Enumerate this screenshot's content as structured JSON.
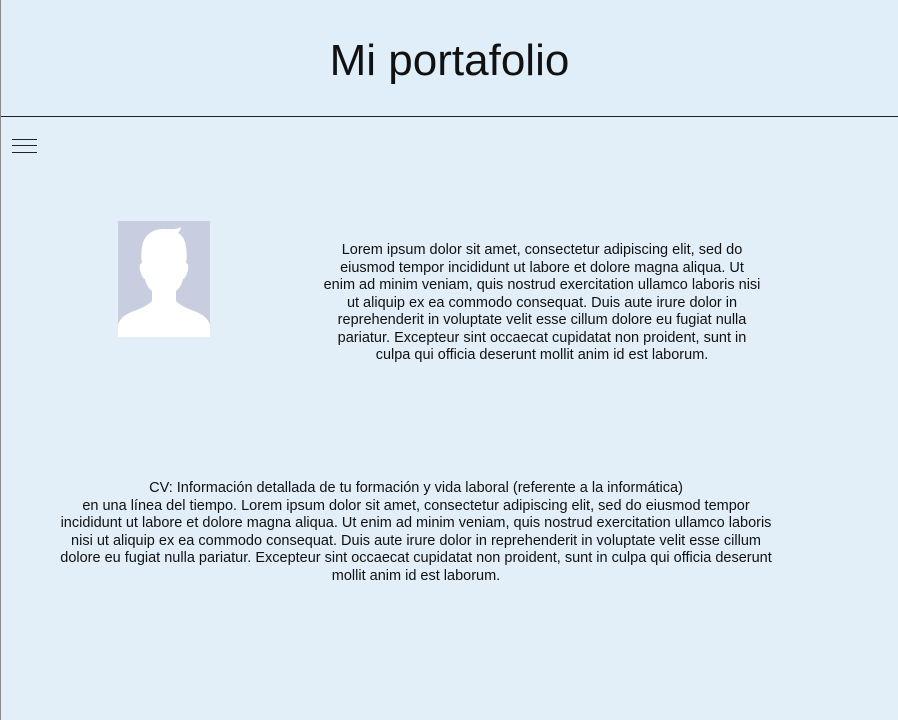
{
  "header": {
    "title": "Mi portafolio"
  },
  "menu": {
    "icon": "hamburger-menu-icon"
  },
  "profile": {
    "avatar_icon": "person-silhouette-icon",
    "avatar_bg": "#c8cde0",
    "intro": "Lorem ipsum dolor sit amet, consectetur adipiscing elit, sed do eiusmod tempor incididunt ut labore et dolore magna aliqua. Ut enim ad minim veniam, quis nostrud exercitation ullamco laboris nisi ut aliquip ex ea commodo consequat. Duis aute irure dolor in reprehenderit in voluptate velit esse cillum dolore eu fugiat nulla pariatur. Excepteur sint occaecat cupidatat non proident, sunt in culpa qui officia deserunt mollit anim id est laborum."
  },
  "cv": {
    "heading": "CV: Información detallada de tu formación y vida laboral (referente a la informática)",
    "body": "en una línea del tiempo. Lorem ipsum dolor sit amet, consectetur adipiscing elit, sed do eiusmod tempor incididunt ut labore et dolore magna aliqua. Ut enim ad minim veniam, quis nostrud exercitation ullamco laboris nisi ut aliquip ex ea commodo consequat. Duis aute irure dolor in reprehenderit in voluptate velit esse cillum dolore eu fugiat nulla pariatur. Excepteur sint occaecat cupidatat non proident, sunt in culpa qui officia deserunt mollit anim id est laborum."
  },
  "colors": {
    "background": "#e2eef8",
    "text": "#111111"
  }
}
